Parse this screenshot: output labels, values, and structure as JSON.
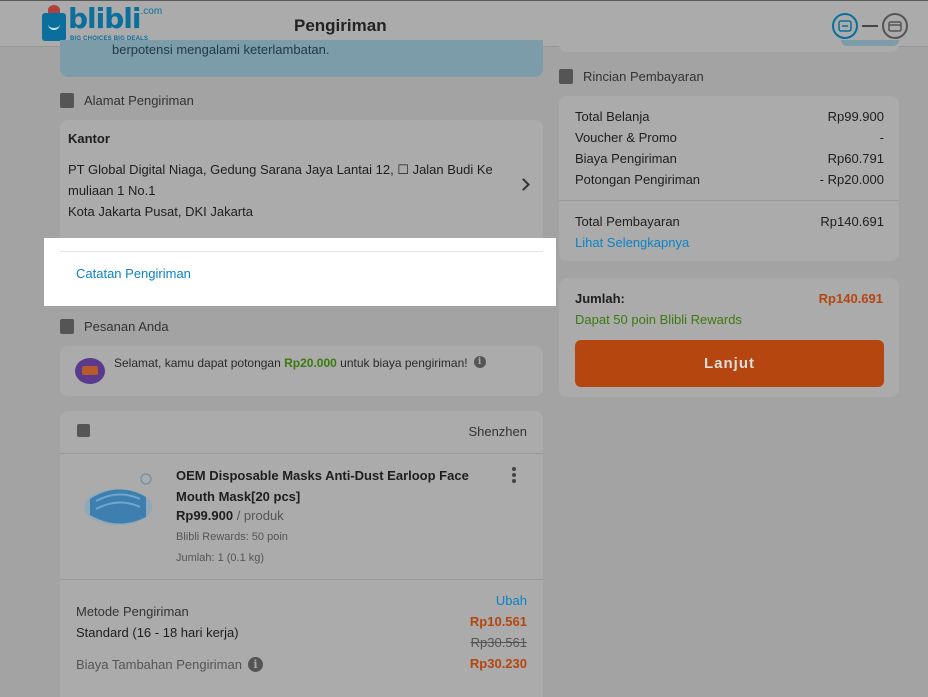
{
  "header": {
    "logo_word": "blibli",
    "logo_com": ".com",
    "logo_tagline": "BIG CHOICES  BIG DEALS",
    "title": "Pengiriman"
  },
  "banner": {
    "text": "berpotensi mengalami keterlambatan."
  },
  "address": {
    "section_title": "Alamat Pengiriman",
    "label": "Kantor",
    "line1": "PT Global Digital Niaga, Gedung Sarana Jaya Lantai 12, ☐ Jalan Budi Ke",
    "line2": "muliaan 1 No.1",
    "line3": "Kota Jakarta Pusat, DKI Jakarta",
    "notes_link": "Catatan Pengiriman"
  },
  "orders": {
    "section_title": "Pesanan Anda",
    "promo_prefix": "Selamat, kamu dapat potongan ",
    "promo_amount": "Rp20.000",
    "promo_suffix": " untuk biaya pengiriman!",
    "store_name": "Shenzhen",
    "product": {
      "title": "OEM Disposable Masks Anti-Dust Earloop Face Mouth Mask[20 pcs]",
      "price": "Rp99.900",
      "price_unit": " / produk",
      "rewards": "Blibli Rewards: 50 poin",
      "qty": "Jumlah: 1 (0.1 kg)"
    },
    "shipping": {
      "method_label": "Metode Pengiriman",
      "method_value": "Standard (16 - 18 hari kerja)",
      "change_link": "Ubah",
      "price_now": "Rp10.561",
      "price_old": "Rp30.561",
      "extra_label": "Biaya Tambahan Pengiriman",
      "extra_value": "Rp30.230"
    }
  },
  "payment": {
    "section_title": "Rincian Pembayaran",
    "rows": [
      {
        "label": "Total Belanja",
        "value": "Rp99.900"
      },
      {
        "label": "Voucher & Promo",
        "value": "-"
      },
      {
        "label": "Biaya Pengiriman",
        "value": "Rp60.791"
      },
      {
        "label": "Potongan Pengiriman",
        "value": "- Rp20.000"
      }
    ],
    "total_label": "Total Pembayaran",
    "total_value": "Rp140.691",
    "details_link": "Lihat Selengkapnya"
  },
  "summary": {
    "label": "Jumlah:",
    "value": "Rp140.691",
    "rewards": "Dapat 50 poin Blibli Rewards",
    "button": "Lanjut"
  },
  "colors": {
    "accent_orange": "#F15A24",
    "link_blue": "#0095DA",
    "reward_green": "#6DBE1E",
    "brand_blue": "#0072BC"
  },
  "icons": [
    "logo-bag-icon",
    "calculator-icon",
    "card-icon",
    "notebook-icon",
    "box-icon",
    "receipt-icon",
    "truck-icon",
    "info-icon",
    "store-icon",
    "chevron-right-icon",
    "kebab-icon"
  ]
}
